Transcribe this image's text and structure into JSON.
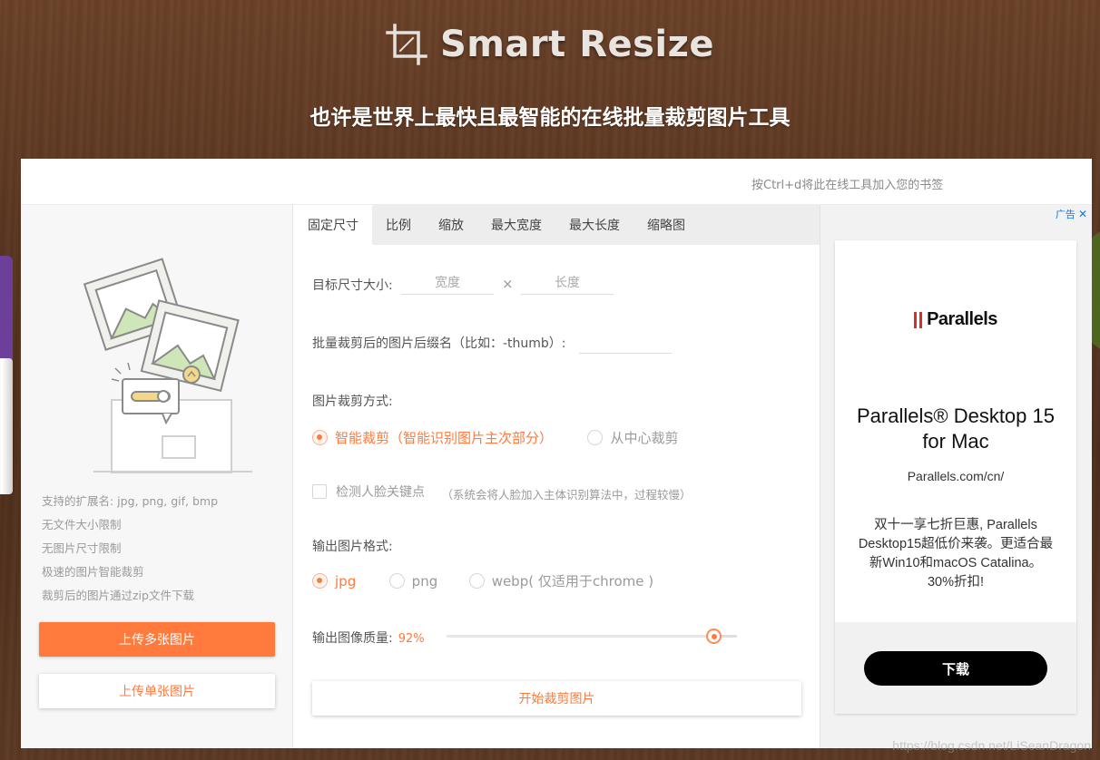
{
  "header": {
    "logo_text": "Smart Resize",
    "tagline": "也许是世界上最快且最智能的在线批量裁剪图片工具"
  },
  "topbar": {
    "bookmark_hint": "按Ctrl+d将此在线工具加入您的书签"
  },
  "left": {
    "features": [
      "支持的扩展名: jpg, png, gif, bmp",
      "无文件大小限制",
      "无图片尺寸限制",
      "极速的图片智能裁剪",
      "裁剪后的图片通过zip文件下载"
    ],
    "upload_multi": "上传多张图片",
    "upload_single": "上传单张图片"
  },
  "tabs": [
    "固定尺寸",
    "比例",
    "缩放",
    "最大宽度",
    "最大长度",
    "缩略图"
  ],
  "form": {
    "target_size_label": "目标尺寸大小:",
    "width_placeholder": "宽度",
    "times": "×",
    "height_placeholder": "长度",
    "suffix_label": "批量裁剪后的图片后缀名（比如：-thumb）:",
    "suffix_value": "",
    "crop_mode_label": "图片裁剪方式:",
    "crop_smart": "智能裁剪（智能识别图片主次部分）",
    "crop_center": "从中心裁剪",
    "face_detect": "检测人脸关键点",
    "face_hint": "（系统会将人脸加入主体识别算法中，过程较慢）",
    "format_label": "输出图片格式:",
    "format_jpg": "jpg",
    "format_png": "png",
    "format_webp": "webp( 仅适用于chrome )",
    "quality_label": "输出图像质量:",
    "quality_value": "92%",
    "quality_fraction": 0.92,
    "start_button": "开始裁剪图片"
  },
  "ad": {
    "label": "广告",
    "close": "✕",
    "brand": "Parallels",
    "title": "Parallels® Desktop 15 for Mac",
    "url": "Parallels.com/cn/",
    "description": "双十一享七折巨惠, Parallels Desktop15超低价来袭。更适合最新Win10和macOS Catalina。30%折扣!",
    "button": "下载"
  },
  "watermark": "https://blog.csdn.net/LiSeanDragon",
  "colors": {
    "accent": "#ff7a3c",
    "ad_brand_red": "#d62d2d"
  }
}
